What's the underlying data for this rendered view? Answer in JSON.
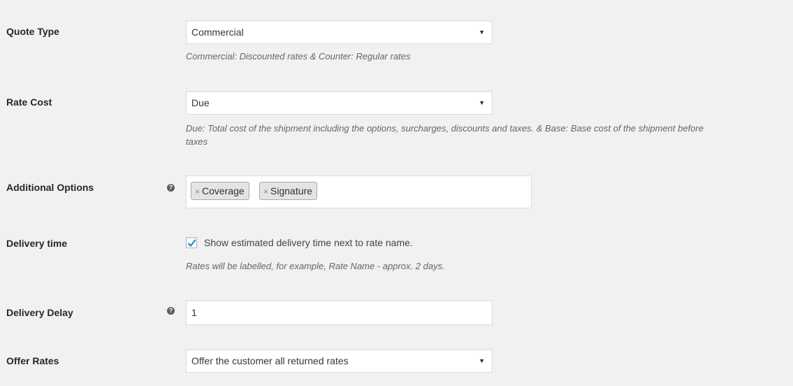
{
  "quote_type": {
    "label": "Quote Type",
    "value": "Commercial",
    "description": "Commercial: Discounted rates & Counter: Regular rates"
  },
  "rate_cost": {
    "label": "Rate Cost",
    "value": "Due",
    "description_line1": "Due: Total cost of the shipment including the options, surcharges, discounts and taxes. & Base: Base cost of the shipment before",
    "description_line2": "taxes"
  },
  "additional_options": {
    "label": "Additional Options",
    "help_icon": "question-circle",
    "remove_glyph": "×",
    "tags": [
      "Coverage",
      "Signature"
    ]
  },
  "delivery_time": {
    "label": "Delivery time",
    "checked": true,
    "checkbox_label": "Show estimated delivery time next to rate name.",
    "description": "Rates will be labelled, for example, Rate Name - approx. 2 days."
  },
  "delivery_delay": {
    "label": "Delivery Delay",
    "help_icon": "question-circle",
    "value": "1"
  },
  "offer_rates": {
    "label": "Offer Rates",
    "value": "Offer the customer all returned rates"
  },
  "colors": {
    "check_accent": "#1e8cbe",
    "background": "#f1f1f1"
  }
}
